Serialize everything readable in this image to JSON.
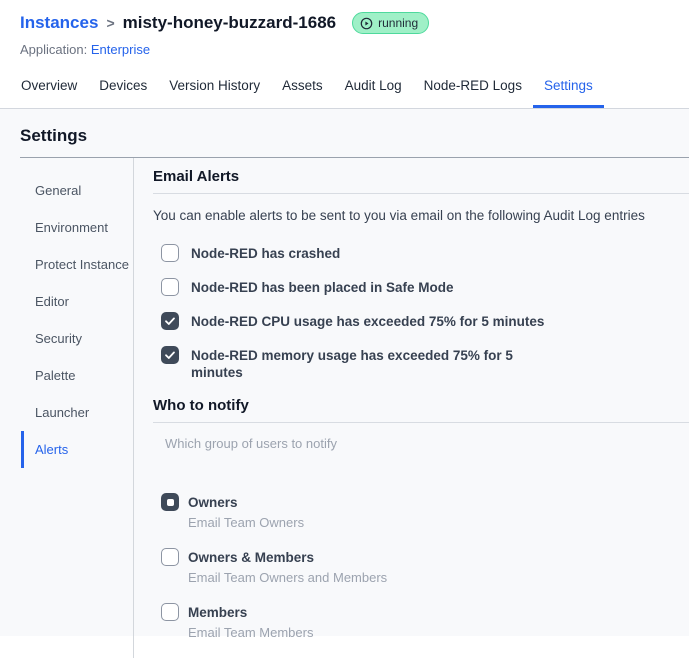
{
  "breadcrumb": {
    "section": "Instances",
    "separator": ">",
    "instance_name": "misty-honey-buzzard-1686"
  },
  "status_badge": {
    "label": "running",
    "icon": "play-circle-icon",
    "bg_color": "#9ff0c7",
    "border_color": "#4ed99c"
  },
  "application": {
    "label": "Application:",
    "name": "Enterprise"
  },
  "tabs": [
    {
      "label": "Overview",
      "active": false
    },
    {
      "label": "Devices",
      "active": false
    },
    {
      "label": "Version History",
      "active": false
    },
    {
      "label": "Assets",
      "active": false
    },
    {
      "label": "Audit Log",
      "active": false
    },
    {
      "label": "Node-RED Logs",
      "active": false
    },
    {
      "label": "Settings",
      "active": true
    }
  ],
  "settings": {
    "title": "Settings"
  },
  "sidebar": {
    "items": [
      {
        "label": "General",
        "active": false
      },
      {
        "label": "Environment",
        "active": false
      },
      {
        "label": "Protect Instance",
        "active": false
      },
      {
        "label": "Editor",
        "active": false
      },
      {
        "label": "Security",
        "active": false
      },
      {
        "label": "Palette",
        "active": false
      },
      {
        "label": "Launcher",
        "active": false
      },
      {
        "label": "Alerts",
        "active": true
      }
    ]
  },
  "email_alerts": {
    "title": "Email Alerts",
    "description": "You can enable alerts to be sent to you via email on the following Audit Log entries",
    "options": [
      {
        "label": "Node-RED has crashed",
        "checked": false
      },
      {
        "label": "Node-RED has been placed in Safe Mode",
        "checked": false
      },
      {
        "label": "Node-RED CPU usage has exceeded 75% for 5 minutes",
        "checked": true
      },
      {
        "label": "Node-RED memory usage has exceeded 75% for 5 minutes",
        "checked": true
      }
    ]
  },
  "who_to_notify": {
    "title": "Who to notify",
    "description": "Which group of users to notify",
    "options": [
      {
        "label": "Owners",
        "description": "Email Team Owners",
        "selected": true
      },
      {
        "label": "Owners & Members",
        "description": "Email Team Owners and Members",
        "selected": false
      },
      {
        "label": "Members",
        "description": "Email Team Members",
        "selected": false
      }
    ]
  },
  "colors": {
    "accent_blue": "#2563eb",
    "checked_fill": "#3f4a59",
    "content_bg": "#f8f9fb",
    "badge_green_bg": "#9ff0c7"
  }
}
